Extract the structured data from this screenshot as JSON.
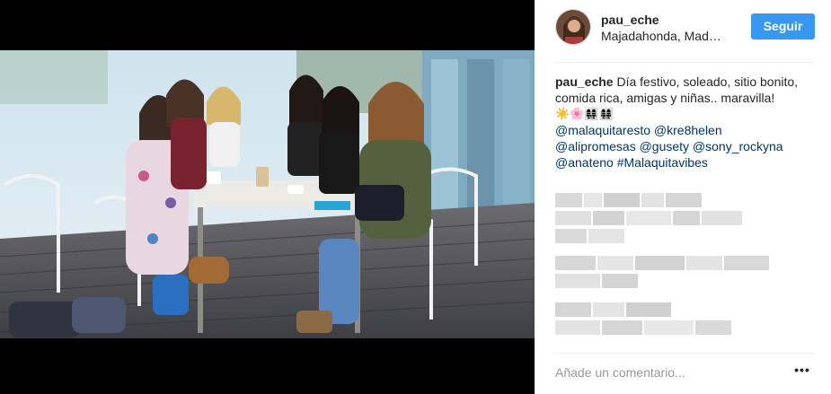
{
  "post": {
    "username": "pau_eche",
    "location": "Majadahonda, Mad…",
    "follow_label": "Seguir",
    "caption": {
      "user": "pau_eche",
      "text": " Día festivo, soleado, sitio bonito, comida rica, amigas y niñas.. maravilla!",
      "emoji_line": "☀️🌸👩‍👩‍👧‍👧👩‍👩‍👧‍👧",
      "tags_line1": "@malaquitaresto @kre8helen",
      "tags_line2": "@alipromesas @gusety @sony_rockyna",
      "tags_line3": "@anateno #Malaquitavibes"
    },
    "comment_placeholder": "Añade un comentario...",
    "more_label": "•••"
  },
  "colors": {
    "accent": "#3897f0",
    "link": "#003569",
    "text": "#262626",
    "muted": "#999999",
    "media_bg": "#000000"
  },
  "icons": {
    "more": "more-options-icon"
  }
}
